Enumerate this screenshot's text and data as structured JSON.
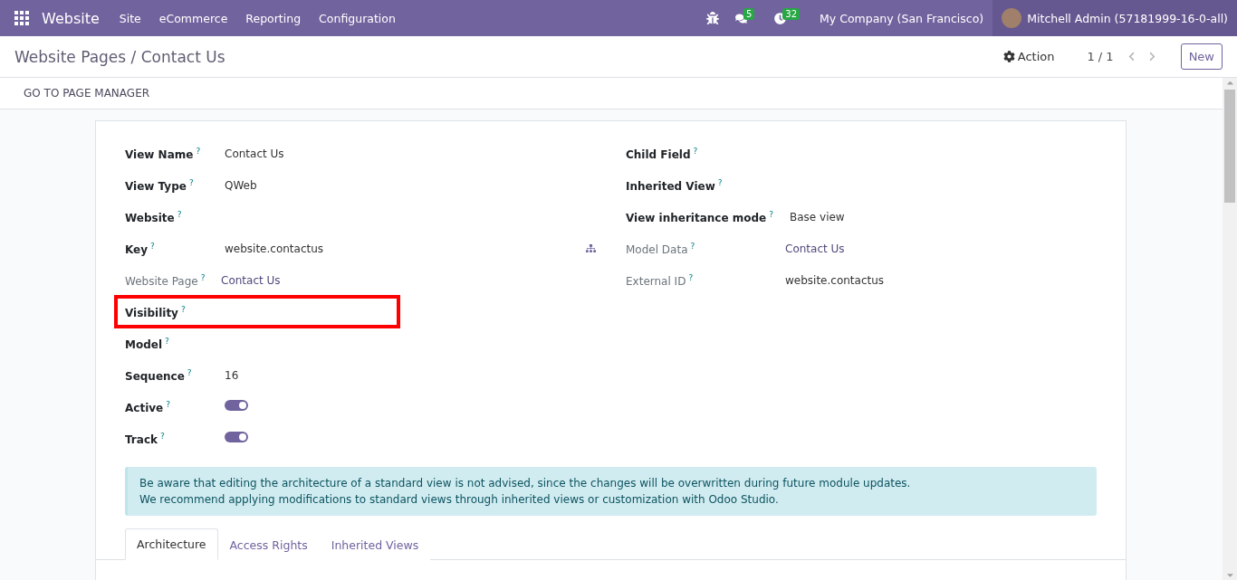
{
  "navbar": {
    "app": "Website",
    "menus": [
      "Site",
      "eCommerce",
      "Reporting",
      "Configuration"
    ],
    "messages_badge": "5",
    "activities_badge": "32",
    "company": "My Company (San Francisco)",
    "user": "Mitchell Admin (57181999-16-0-all)"
  },
  "control_panel": {
    "breadcrumb": "Website Pages / Contact Us",
    "action": "Action",
    "pager": "1 / 1",
    "new_button": "New"
  },
  "button_bar": {
    "button": "GO TO PAGE MANAGER"
  },
  "left_fields": [
    {
      "label": "View Name",
      "help": "?",
      "value": "Contact Us",
      "kind": "text",
      "muted": false,
      "highlighted": false
    },
    {
      "label": "View Type",
      "help": "?",
      "value": "QWeb",
      "kind": "text",
      "muted": false,
      "highlighted": false
    },
    {
      "label": "Website",
      "help": "?",
      "kind": "text",
      "muted": false,
      "highlighted": false
    },
    {
      "label": "Key",
      "help": "?",
      "value": "website.contactus",
      "kind": "key",
      "muted": false,
      "highlighted": false
    },
    {
      "label": "Website Page",
      "help": "?",
      "value": "Contact Us",
      "kind": "link",
      "muted": true,
      "highlighted": false
    },
    {
      "label": "Visibility",
      "help": "?",
      "kind": "text",
      "muted": false,
      "highlighted": true
    },
    {
      "label": "Model",
      "help": "?",
      "kind": "text",
      "muted": false,
      "highlighted": false
    },
    {
      "label": "Sequence",
      "help": "?",
      "value": "16",
      "kind": "text",
      "muted": false,
      "highlighted": false
    },
    {
      "label": "Active",
      "help": "?",
      "kind": "toggle",
      "on": true,
      "muted": false,
      "highlighted": false
    },
    {
      "label": "Track",
      "help": "?",
      "kind": "toggle",
      "on": true,
      "muted": false,
      "highlighted": false
    }
  ],
  "right_fields": [
    {
      "label": "Child Field",
      "help": "?",
      "kind": "text",
      "muted": false
    },
    {
      "label": "Inherited View",
      "help": "?",
      "kind": "text",
      "muted": false
    },
    {
      "label": "View inheritance mode",
      "help": "?",
      "value": "Base view",
      "kind": "select",
      "muted": false
    },
    {
      "label": "Model Data",
      "help": "?",
      "value": "Contact Us",
      "kind": "link",
      "muted": true
    },
    {
      "label": "External ID",
      "help": "?",
      "value": "website.contactus",
      "kind": "text",
      "muted": true
    }
  ],
  "alert": [
    "Be aware that editing the architecture of a standard view is not advised, since the changes will be overwritten during future module updates.",
    "We recommend applying modifications to standard views through inherited views or customization with Odoo Studio."
  ],
  "tabs": [
    {
      "label": "Architecture",
      "selected": true
    },
    {
      "label": "Access Rights",
      "selected": false
    },
    {
      "label": "Inherited Views",
      "selected": false
    }
  ]
}
